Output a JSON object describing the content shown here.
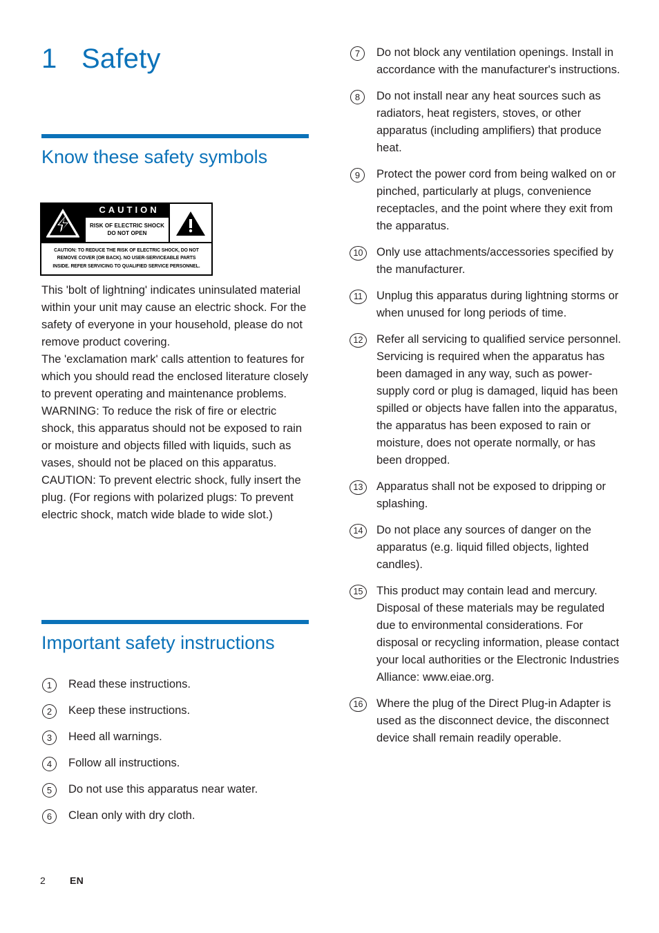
{
  "document": {
    "chapter_number": "1",
    "chapter_title": "Safety",
    "accent_color": "#0b72b9",
    "text_color": "#231f20"
  },
  "left_column": {
    "section1": {
      "heading": "Know these safety symbols",
      "caution_graphic": {
        "caution_word": "CAUTION",
        "risk_line1": "RISK OF ELECTRIC SHOCK",
        "risk_line2": "DO NOT OPEN",
        "note_line1": "CAUTION: TO REDUCE THE RISK OF ELECTRIC SHOCK, DO NOT",
        "note_line2": "REMOVE COVER (OR BACK). NO USER-SERVICEABLE PARTS",
        "note_line3": "INSIDE. REFER SERVICING TO QUALIFIED SERVICE PERSONNEL.",
        "left_symbol": "lightning-bolt-triangle-icon",
        "right_symbol": "exclamation-mark-triangle-icon"
      },
      "paragraphs": [
        "This 'bolt of lightning' indicates uninsulated material within your unit may cause an electric shock. For the safety of everyone in your household, please do not remove product covering.",
        "The 'exclamation mark' calls attention to features for which you should read the enclosed literature closely to prevent operating and maintenance problems.",
        "WARNING: To reduce the risk of fire or electric shock, this apparatus should not be exposed to rain or moisture and objects filled with liquids, such as vases, should not be placed on this apparatus.",
        "CAUTION: To prevent electric shock, fully insert the plug. (For regions with polarized plugs: To prevent electric shock, match wide blade to wide slot.)"
      ]
    },
    "section2": {
      "heading": "Important safety instructions",
      "items": [
        {
          "number": "1",
          "text": "Read these instructions."
        },
        {
          "number": "2",
          "text": "Keep these instructions."
        },
        {
          "number": "3",
          "text": "Heed all warnings."
        },
        {
          "number": "4",
          "text": "Follow all instructions."
        },
        {
          "number": "5",
          "text": "Do not use this apparatus near water."
        },
        {
          "number": "6",
          "text": "Clean only with dry cloth."
        }
      ]
    }
  },
  "right_column": {
    "items": [
      {
        "number": "7",
        "text": "Do not block any ventilation openings. Install in accordance with the manufacturer's instructions."
      },
      {
        "number": "8",
        "text": "Do not install near any heat sources such as radiators, heat registers, stoves, or other apparatus (including amplifiers) that produce heat."
      },
      {
        "number": "9",
        "text": "Protect the power cord from being walked on or pinched, particularly at plugs, convenience receptacles, and the point where they exit from the apparatus."
      },
      {
        "number": "10",
        "text": "Only use attachments/accessories specified by the manufacturer."
      },
      {
        "number": "11",
        "text": "Unplug this apparatus during lightning storms or when unused for long periods of time."
      },
      {
        "number": "12",
        "text": "Refer all servicing to qualified service personnel. Servicing is required when the apparatus has been damaged in any way, such as power-supply cord or plug is damaged, liquid has been spilled or objects have fallen into the apparatus, the apparatus has been exposed to rain or moisture, does not operate normally, or has been dropped."
      },
      {
        "number": "13",
        "text": "Apparatus shall not be exposed to dripping or splashing."
      },
      {
        "number": "14",
        "text": "Do not place any sources of danger on the apparatus (e.g. liquid filled objects, lighted candles)."
      },
      {
        "number": "15",
        "text": "This product may contain lead and mercury. Disposal of these materials may be regulated due to environmental considerations. For disposal or recycling information, please contact your local authorities or the Electronic Industries Alliance: www.eiae.org."
      },
      {
        "number": "16",
        "text": "Where the plug of the Direct Plug-in Adapter is used as the disconnect device, the disconnect device shall remain readily operable."
      }
    ]
  },
  "footer": {
    "page_number": "2",
    "language": "EN"
  }
}
